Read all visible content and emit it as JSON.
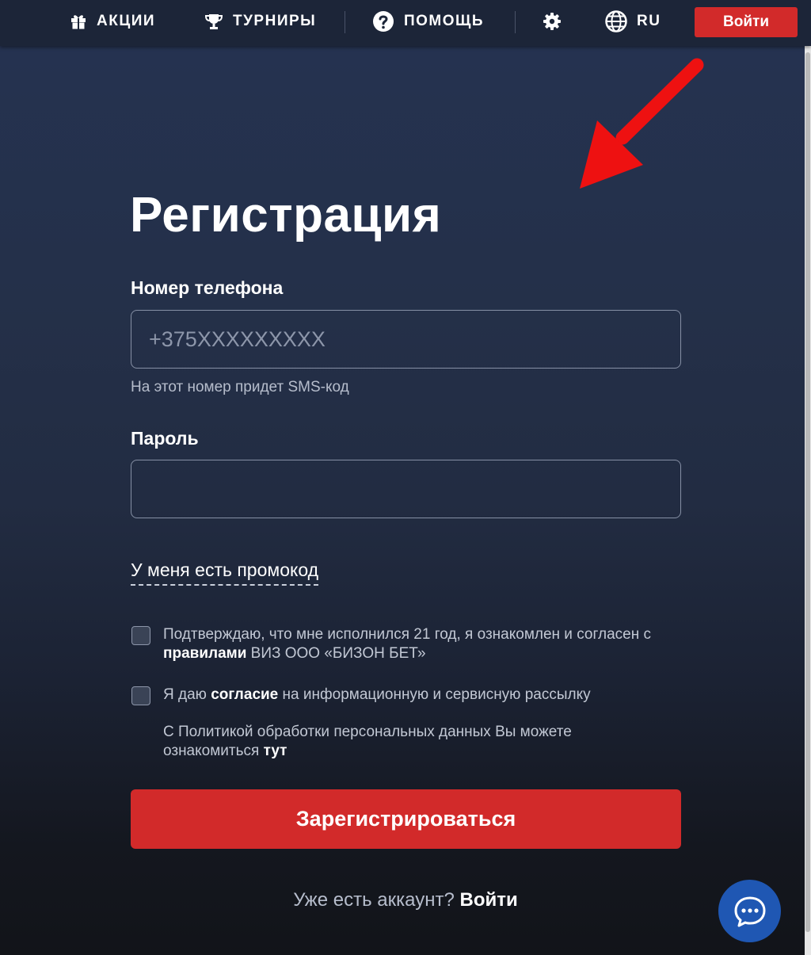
{
  "nav": {
    "promotions": "АКЦИИ",
    "tournaments": "ТУРНИРЫ",
    "help": "ПОМОЩЬ",
    "language": "RU",
    "login": "Войти"
  },
  "form": {
    "title": "Регистрация",
    "phone_label": "Номер телефона",
    "phone_placeholder": "+375XXXXXXXXX",
    "phone_value": "",
    "phone_hint": "На этот номер придет SMS-код",
    "password_label": "Пароль",
    "password_value": "",
    "promo_link": "У меня есть промокод",
    "age_check": {
      "text_1": "Подтверждаю, что мне исполнился 21 год, я ознакомлен и согласен с ",
      "rules_link": "правилами",
      "text_2": " ВИЗ ООО «БИЗОН БЕТ»",
      "checked": false
    },
    "mailing_check": {
      "text_1": "Я даю ",
      "consent_link": "согласие",
      "text_2": " на информационную и сервисную рассылку",
      "checked": false
    },
    "policy_note": {
      "text": "С Политикой обработки персональных данных Вы можете ознакомиться ",
      "link": "тут"
    },
    "submit": "Зарегистрироваться",
    "have_account": "Уже есть аккаунт?",
    "login_link": "Войти"
  },
  "icons": {
    "promotions": "gift-icon",
    "tournaments": "trophy-icon",
    "help": "question-circle-icon",
    "settings": "gear-icon",
    "language": "globe-icon",
    "chat": "chat-bubble-icon",
    "annotation": "red-arrow-icon"
  },
  "colors": {
    "accent_red": "#d22a2a",
    "topbar": "#1c2538",
    "chat_blue": "#1f57b3"
  }
}
